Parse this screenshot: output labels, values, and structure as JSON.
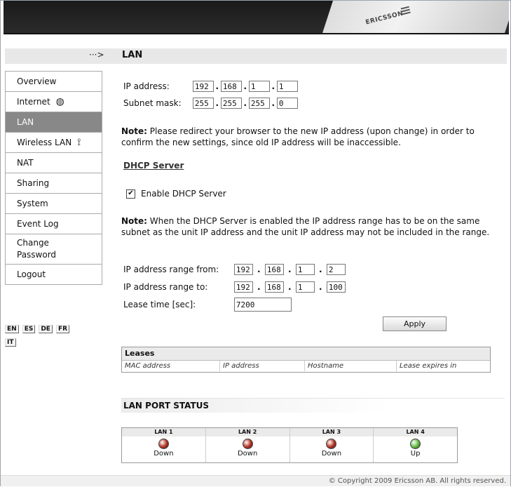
{
  "banner": {
    "brand": "ERICSSON"
  },
  "header": {
    "arrow": "···>",
    "title": "LAN"
  },
  "sidebar": {
    "items": [
      {
        "label": "Overview"
      },
      {
        "label": "Internet",
        "icon": "globe-icon"
      },
      {
        "label": "LAN",
        "active": true
      },
      {
        "label": "Wireless LAN",
        "icon": "antenna-icon"
      },
      {
        "label": "NAT"
      },
      {
        "label": "Sharing"
      },
      {
        "label": "System"
      },
      {
        "label": "Event Log"
      },
      {
        "label_line1": "Change",
        "label_line2": "Password"
      },
      {
        "label": "Logout"
      }
    ]
  },
  "languages": [
    "EN",
    "ES",
    "DE",
    "FR",
    "IT"
  ],
  "lan": {
    "ip_label": "IP address:",
    "ip": [
      "192",
      "168",
      "1",
      "1"
    ],
    "mask_label": "Subnet mask:",
    "mask": [
      "255",
      "255",
      "255",
      "0"
    ],
    "note1_bold": "Note:",
    "note1_text": " Please redirect your browser to the new IP address (upon change) in order to confirm the new settings, since old IP address will be inaccessible."
  },
  "dhcp": {
    "heading": "DHCP Server",
    "enable_label": "Enable DHCP Server",
    "enabled": true,
    "note_bold": "Note:",
    "note_text": " When the DHCP Server is enabled the IP address range has to be on the same subnet as the unit IP address and the unit IP address may not be included in the range.",
    "from_label": "IP address range from:",
    "from": [
      "192",
      "168",
      "1",
      "2"
    ],
    "to_label": "IP address range to:",
    "to": [
      "192",
      "168",
      "1",
      "100"
    ],
    "lease_label": "Lease time [sec]:",
    "lease_value": "7200",
    "apply_label": "Apply"
  },
  "leases": {
    "title": "Leases",
    "columns": [
      "MAC address",
      "IP address",
      "Hostname",
      "Lease expires in"
    ]
  },
  "port_status": {
    "heading": "LAN PORT STATUS",
    "ports": [
      {
        "name": "LAN 1",
        "status": "Down",
        "color": "#b22a1a"
      },
      {
        "name": "LAN 2",
        "status": "Down",
        "color": "#b22a1a"
      },
      {
        "name": "LAN 3",
        "status": "Down",
        "color": "#b22a1a"
      },
      {
        "name": "LAN 4",
        "status": "Up",
        "color": "#5cb83a"
      }
    ]
  },
  "footer": {
    "copyright": "© Copyright 2009 Ericsson AB. All rights reserved."
  }
}
